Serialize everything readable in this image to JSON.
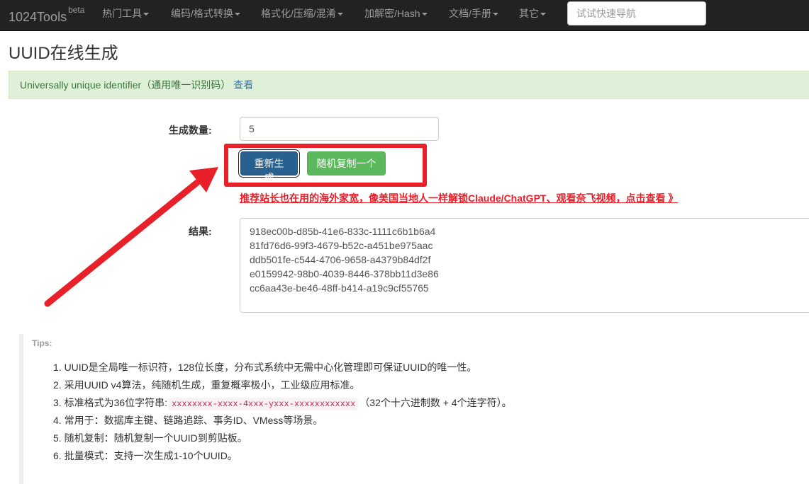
{
  "navbar": {
    "brand": "1024Tools",
    "brand_sup": "beta",
    "items": [
      {
        "label": "热门工具"
      },
      {
        "label": "编码/格式转换"
      },
      {
        "label": "格式化/压缩/混淆"
      },
      {
        "label": "加解密/Hash"
      },
      {
        "label": "文档/手册"
      },
      {
        "label": "其它"
      }
    ],
    "search_placeholder": "试试快速导航"
  },
  "page": {
    "title": "UUID在线生成",
    "alert_text": "Universally unique identifier（通用唯一识别码）",
    "alert_link": "查看"
  },
  "form": {
    "quantity_label": "生成数量:",
    "quantity_value": "5",
    "regenerate_label": "重新生成",
    "copy_random_label": "随机复制一个",
    "promo_text": "推荐站长也在用的海外家宽，像美国当地人一样解锁Claude/ChatGPT、观看奈飞视频，点击查看 》",
    "result_label": "结果:",
    "results": [
      "918ec00b-d85b-41e6-833c-1111c6b1b6a4",
      "81fd76d6-99f3-4679-b52c-a451be975aac",
      "ddb501fe-c544-4706-9658-a4379b84df2f",
      "e0159942-98b0-4039-8446-378bb11d3e86",
      "cc6aa43e-be46-48ff-b414-a19c9cf55765"
    ]
  },
  "tips": {
    "title": "Tips:",
    "items": [
      {
        "text": "1. UUID是全局唯一标识符，128位长度，分布式系统中无需中心化管理即可保证UUID的唯一性。"
      },
      {
        "text": "2. 采用UUID v4算法，纯随机生成，重复概率极小，工业级应用标准。"
      },
      {
        "prefix": "3. 标准格式为36位字符串:",
        "code": "xxxxxxxx-xxxx-4xxx-yxxx-xxxxxxxxxxxx",
        "suffix": "（32个十六进制数 + 4个连字符）。"
      },
      {
        "text": "4. 常用于：数据库主键、链路追踪、事务ID、VMess等场景。"
      },
      {
        "text": "5. 随机复制：随机复制一个UUID到剪贴板。"
      },
      {
        "text": "6. 批量模式：支持一次生成1-10个UUID。"
      }
    ]
  },
  "colors": {
    "navbar_bg": "#222222",
    "primary": "#286090",
    "success": "#5cb85c",
    "annotation_red": "#e8202a",
    "alert_bg": "#dff0d8"
  }
}
